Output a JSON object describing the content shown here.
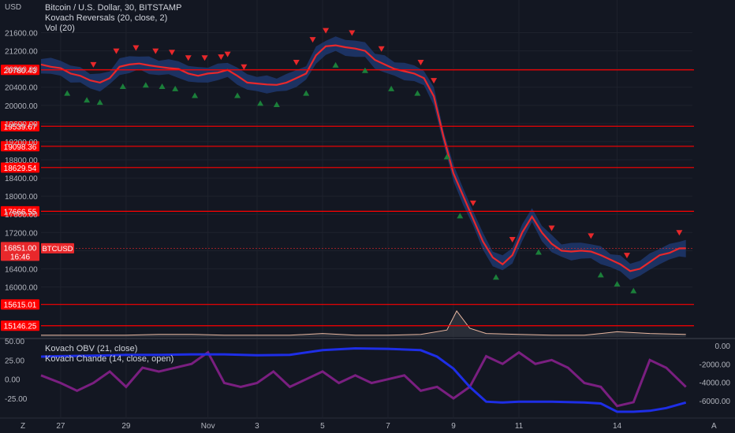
{
  "symbol": {
    "currency": "USD",
    "title": "Bitcoin / U.S. Dollar, 30, BITSTAMP",
    "price_tag": "16851.00",
    "countdown": "16:46",
    "ticker_badge": "BTCUSD"
  },
  "legend": {
    "main": [
      "Kovach Reversals (20, close, 2)",
      "Vol (20)"
    ],
    "lower": [
      "Kovach OBV (21, close)",
      "Kovach Chande (14, close, open)"
    ]
  },
  "corner": {
    "left": "Z",
    "right": "A"
  },
  "colors": {
    "background": "#131722",
    "price_line": "#e8282b",
    "band": "#1f3a73",
    "level_line": "#ff0000",
    "up_marker": "#1b7f3a",
    "down_marker": "#e8282b",
    "obv": "#1e2ee6",
    "chande": "#7a1f80",
    "volume_line": "#e8b7a0",
    "grid": "#1e222d",
    "axis_text": "#b2b5be"
  },
  "chart_data": [
    {
      "type": "line",
      "name": "price",
      "ylim": [
        15000,
        21900
      ],
      "y_ticks": [
        "21600.00",
        "21200.00",
        "20800.00",
        "20400.00",
        "20000.00",
        "19600.00",
        "19200.00",
        "18800.00",
        "18400.00",
        "18000.00",
        "17600.00",
        "17200.00",
        "16800.00",
        "16400.00",
        "16000.00"
      ],
      "y_tick_values": [
        21600,
        21200,
        20800,
        20400,
        20000,
        19600,
        19200,
        18800,
        18400,
        18000,
        17600,
        17200,
        16800,
        16400,
        16000
      ],
      "x_ticks": [
        "27",
        "29",
        "Nov",
        "3",
        "5",
        "7",
        "9",
        "11",
        "14"
      ],
      "x_tick_positions": [
        0.0,
        2.0,
        4.5,
        6.0,
        8.0,
        10.0,
        12.0,
        14.0,
        17.0
      ],
      "xlim": [
        -0.6,
        19.3
      ],
      "x": [
        -0.6,
        -0.3,
        0,
        0.3,
        0.6,
        0.9,
        1.2,
        1.5,
        1.8,
        2.1,
        2.4,
        2.7,
        3.0,
        3.3,
        3.6,
        3.9,
        4.2,
        4.5,
        4.8,
        5.1,
        5.4,
        5.7,
        6.0,
        6.3,
        6.6,
        6.9,
        7.2,
        7.5,
        7.8,
        8.1,
        8.4,
        8.7,
        9.0,
        9.3,
        9.6,
        9.9,
        10.2,
        10.5,
        10.8,
        11.1,
        11.4,
        11.7,
        12.0,
        12.3,
        12.6,
        12.9,
        13.2,
        13.5,
        13.8,
        14.1,
        14.4,
        14.7,
        15.0,
        15.3,
        15.6,
        15.9,
        16.2,
        16.5,
        16.8,
        17.1,
        17.4,
        17.7,
        18.0,
        18.3,
        18.6,
        18.9,
        19.1
      ],
      "values": [
        20900,
        20850,
        20820,
        20700,
        20650,
        20550,
        20500,
        20600,
        20850,
        20900,
        20920,
        20880,
        20850,
        20820,
        20800,
        20700,
        20650,
        20700,
        20720,
        20780,
        20650,
        20500,
        20480,
        20460,
        20450,
        20500,
        20600,
        20700,
        21100,
        21300,
        21320,
        21280,
        21250,
        21200,
        21000,
        20900,
        20800,
        20750,
        20700,
        20600,
        20200,
        19300,
        18500,
        18000,
        17500,
        17000,
        16650,
        16500,
        16700,
        17200,
        17550,
        17200,
        16950,
        16800,
        16780,
        16800,
        16780,
        16700,
        16600,
        16500,
        16350,
        16400,
        16550,
        16700,
        16750,
        16850,
        16851
      ],
      "levels": [
        20780.43,
        19539.67,
        19098.36,
        18629.54,
        17666.55,
        15615.01,
        15146.25
      ],
      "level_labels": [
        "20780.43",
        "19539.67",
        "19098.36",
        "18629.54",
        "17666.55",
        "15615.01",
        "15146.25"
      ],
      "down_markers_x": [
        1.0,
        1.7,
        2.3,
        2.9,
        3.4,
        3.9,
        4.4,
        4.9,
        5.1,
        5.6,
        7.2,
        7.7,
        8.1,
        8.9,
        9.8,
        11.0,
        11.4,
        12.6,
        13.8,
        15.0,
        16.2,
        17.3,
        18.9
      ],
      "up_markers_x": [
        0.2,
        0.8,
        1.2,
        1.9,
        2.6,
        3.1,
        3.5,
        4.1,
        5.4,
        6.1,
        6.6,
        7.5,
        8.4,
        9.3,
        10.1,
        10.9,
        11.8,
        12.2,
        13.3,
        14.6,
        16.5,
        17.0,
        17.5
      ]
    },
    {
      "type": "line",
      "name": "Kovach OBV",
      "ylim": [
        -7000,
        500
      ],
      "y_ticks": [
        "0.00",
        "-2000.00",
        "-4000.00",
        "-6000.00"
      ],
      "y_tick_values": [
        0,
        -2000,
        -4000,
        -6000
      ],
      "x": [
        -0.6,
        0,
        1,
        2,
        3,
        4,
        5,
        6,
        7,
        8,
        9,
        10,
        11,
        11.5,
        12,
        12.5,
        13,
        13.5,
        14,
        15,
        16,
        16.5,
        17,
        17.5,
        18,
        18.5,
        19.1
      ],
      "values": [
        -1200,
        -1150,
        -1100,
        -1000,
        -1000,
        -950,
        -950,
        -1050,
        -1000,
        -500,
        -300,
        -350,
        -500,
        -1200,
        -2500,
        -4500,
        -6100,
        -6200,
        -6100,
        -6100,
        -6200,
        -6300,
        -7200,
        -7200,
        -7100,
        -6800,
        -6200
      ]
    },
    {
      "type": "line",
      "name": "Kovach Chande",
      "ylim": [
        -45,
        55
      ],
      "y_ticks": [
        "50.00",
        "25.00",
        "0.00",
        "-25.00"
      ],
      "y_tick_values": [
        50,
        25,
        0,
        -25
      ],
      "x": [
        -0.6,
        0,
        0.5,
        1,
        1.5,
        2,
        2.5,
        3,
        3.5,
        4,
        4.5,
        5,
        5.5,
        6,
        6.5,
        7,
        7.5,
        8,
        8.5,
        9,
        9.5,
        10,
        10.5,
        11,
        11.5,
        12,
        12.5,
        13,
        13.5,
        14,
        14.5,
        15,
        15.5,
        16,
        16.5,
        17,
        17.5,
        18,
        18.5,
        19.1
      ],
      "values": [
        5,
        -5,
        -15,
        -5,
        10,
        -10,
        15,
        10,
        15,
        20,
        35,
        -5,
        -10,
        -5,
        10,
        -10,
        0,
        10,
        -5,
        5,
        -5,
        0,
        5,
        -15,
        -10,
        -25,
        -10,
        30,
        20,
        35,
        20,
        25,
        15,
        -5,
        -10,
        -35,
        -30,
        25,
        15,
        -10
      ]
    },
    {
      "type": "area",
      "name": "volume",
      "x": [
        -0.6,
        1,
        2,
        3,
        4,
        5,
        6,
        7,
        8,
        9,
        10,
        11,
        11.8,
        12.1,
        12.5,
        13,
        14,
        15,
        16,
        17,
        18,
        19.1
      ],
      "values": [
        2,
        2,
        2,
        3,
        3,
        2,
        2,
        2,
        4,
        2,
        2,
        3,
        8,
        30,
        10,
        4,
        3,
        2,
        2,
        6,
        4,
        3
      ]
    }
  ]
}
